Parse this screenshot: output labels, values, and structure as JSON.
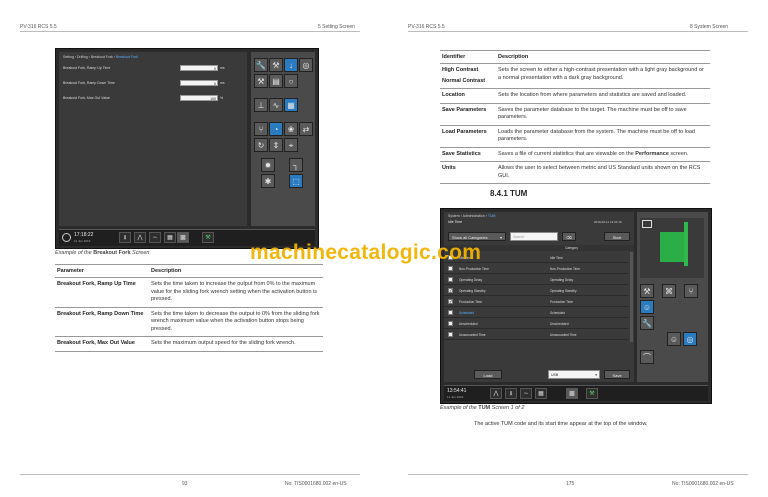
{
  "header": {
    "left_doc": "PV-316 RCS 5.5",
    "left_section": "5 Setting Screen",
    "right_doc": "PV-316 RCS 5.5",
    "right_section": "8 System Screen"
  },
  "footer": {
    "left_page": "93",
    "left_docno": "No: TIS0001680.002 en-US",
    "right_page": "175",
    "right_docno": "No: TIS0001680.002 en-US"
  },
  "watermark": "machinecatalogic.com",
  "breakout_screen": {
    "breadcrumb_prefix": "Setting › Drilling › Breakout Fork ›",
    "breadcrumb_current": "Breakout Fork",
    "params": [
      {
        "label": "Breakout Fork, Ramp Up Time",
        "value": "0",
        "unit": "ms"
      },
      {
        "label": "Breakout Fork, Ramp Down Time",
        "value": "0",
        "unit": "ms"
      },
      {
        "label": "Breakout Fork, Max Out Value",
        "value": "100",
        "unit": "%"
      }
    ],
    "status": {
      "time": "17:18:22",
      "date": "11 Jun 2019"
    },
    "icons": [
      "wrench-icon",
      "hammer-icon",
      "drill-icon",
      "globe-icon",
      "tools-icon",
      "box-icon",
      "ring-icon",
      "wave-icon",
      "grid-icon",
      "fork-icon",
      "gauge-icon",
      "fan-icon",
      "swap-icon",
      "arrows-icon",
      "lift-icon",
      "star-icon",
      "pipe-icon",
      "cycle-icon",
      "selected-icon"
    ]
  },
  "breakout_caption": {
    "prefix": "Example of the ",
    "bold": "Breakout Fork",
    "suffix": " Screen"
  },
  "breakout_table": {
    "headers": [
      "Parameter",
      "Description"
    ],
    "rows": [
      {
        "param": "Breakout Fork, Ramp Up Time",
        "desc": "Sets the time taken to increase the output from 0% to the maximum value for the sliding fork wrench setting when the activation button is pressed."
      },
      {
        "param": "Breakout Fork, Ramp Down Time",
        "desc": "Sets the time taken to decrease the output to 0% from the sliding fork wrench maximum value when the activation button stops being pressed."
      },
      {
        "param": "Breakout Fork, Max Out Value",
        "desc": "Sets the maximum output speed for the sliding fork wrench."
      }
    ]
  },
  "system_table": {
    "headers": [
      "Identifier",
      "Description"
    ],
    "rows": [
      {
        "id": "High Contrast",
        "id2": "Normal Contrast",
        "desc": "Sets the screen to either a high-contrast presentation with a light gray background or a normal presentation with a dark gray background."
      },
      {
        "id": "Location",
        "desc": "Sets the location from where parameters and statistics are saved and loaded."
      },
      {
        "id": "Save Parameters",
        "desc": "Saves the parameter database to the target. The machine must be off to save parameters."
      },
      {
        "id": "Load Parameters",
        "desc": "Loads the parameter database from the system. The machine must be off to load parameters."
      },
      {
        "id": "Save Statistics",
        "desc_pre": "Saves a file of current statistics that are viewable on the ",
        "desc_bold": "Performance",
        "desc_post": " screen."
      },
      {
        "id": "Units",
        "desc": "Allows the user to select between metric and US Standard units shown on the RCS GUI."
      }
    ]
  },
  "tum_section": {
    "heading": "8.4.1 TUM"
  },
  "tum_screen": {
    "breadcrumb_prefix": "System › Administration ›",
    "breadcrumb_current": "TUM",
    "title": "Idle Time",
    "start_time": "2019-06-11 12:01:16",
    "filter": "Show all Categories",
    "search_placeholder": "Search",
    "start_button": "Start",
    "col_category": "Category",
    "rows": [
      {
        "code": "Idle Time",
        "cat": "Idle Time",
        "checked": false
      },
      {
        "code": "Non-Production Time",
        "cat": "Non-Production Time",
        "checked": false
      },
      {
        "code": "Operating Delay",
        "cat": "Operating Delay",
        "checked": false
      },
      {
        "code": "Operating Standby",
        "cat": "Operating Standby",
        "checked": true
      },
      {
        "code": "Production Time",
        "cat": "Production Time",
        "checked": true
      },
      {
        "code": "Scheduled",
        "cat": "Scheduled",
        "checked": false
      },
      {
        "code": "Unscheduled",
        "cat": "Unscheduled",
        "checked": false
      },
      {
        "code": "Unaccounted Time",
        "cat": "Unaccounted Time",
        "checked": false
      }
    ],
    "load_button": "Load",
    "location": "USB",
    "save_button": "Save",
    "status": {
      "time": "13:54:41",
      "date": "11 Jun 2019"
    }
  },
  "tum_caption": {
    "prefix": "Example of the ",
    "bold": "TUM",
    "suffix": " Screen 1 of 2"
  },
  "tum_note": "The active TUM code and its start time appear at the top of the window."
}
